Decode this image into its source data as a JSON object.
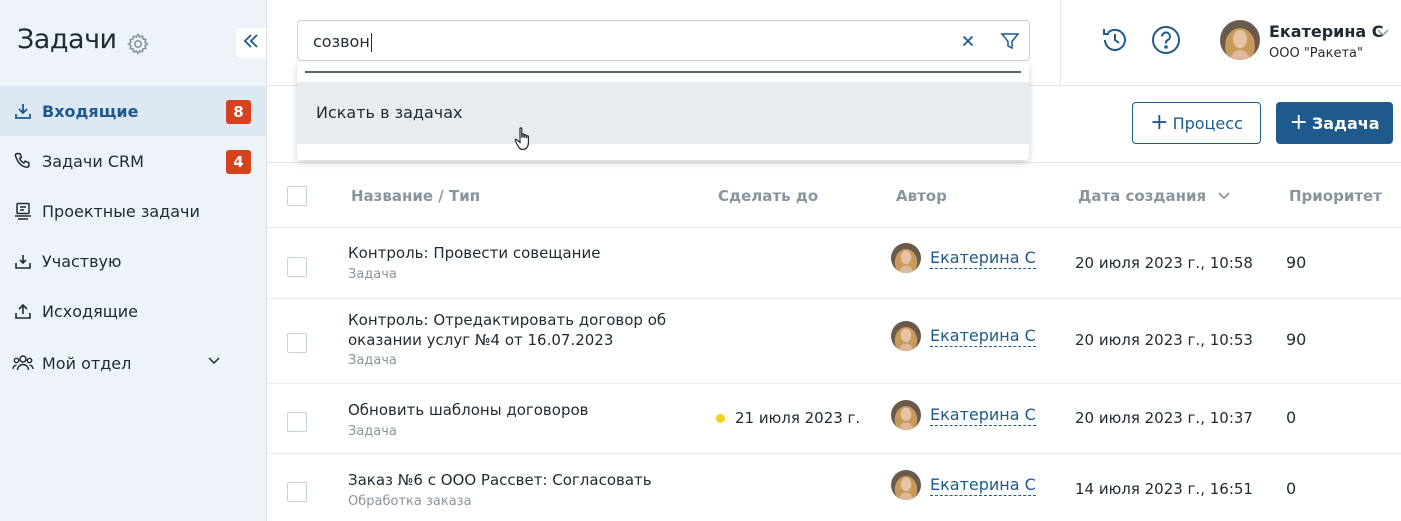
{
  "sidebar": {
    "title": "Задачи",
    "items": [
      {
        "label": "Входящие",
        "badge": "8",
        "icon": "inbox-icon"
      },
      {
        "label": "Задачи CRM",
        "badge": "4",
        "icon": "phone-icon"
      },
      {
        "label": "Проектные задачи",
        "badge": null,
        "icon": "project-icon"
      },
      {
        "label": "Участвую",
        "badge": null,
        "icon": "participate-icon"
      },
      {
        "label": "Исходящие",
        "badge": null,
        "icon": "outbox-icon"
      },
      {
        "label": "Мой отдел",
        "badge": null,
        "icon": "team-icon"
      }
    ]
  },
  "search": {
    "value": "созвон",
    "suggestion": "Искать в задачах"
  },
  "user": {
    "name": "Екатерина С",
    "org": "ООО \"Ракета\""
  },
  "actions": {
    "process_label": "Процесс",
    "task_label": "Задача"
  },
  "table": {
    "columns": {
      "title": "Название / Тип",
      "due": "Сделать до",
      "author": "Автор",
      "created": "Дата создания",
      "priority": "Приоритет"
    },
    "rows": [
      {
        "title": "Контроль: Провести совещание",
        "type": "Задача",
        "due": "",
        "author": "Екатерина С",
        "created": "20 июля 2023 г., 10:58",
        "priority": "90"
      },
      {
        "title": "Контроль: Отредактировать договор об оказании услуг №4 от 16.07.2023",
        "type": "Задача",
        "due": "",
        "author": "Екатерина С",
        "created": "20 июля 2023 г., 10:53",
        "priority": "90"
      },
      {
        "title": "Обновить шаблоны договоров",
        "type": "Задача",
        "due": "21 июля 2023 г.",
        "author": "Екатерина С",
        "created": "20 июля 2023 г., 10:37",
        "priority": "0"
      },
      {
        "title": "Заказ №6 с ООО Рассвет: Согласовать",
        "type": "Обработка заказа",
        "due": "",
        "author": "Екатерина С",
        "created": "14 июля 2023 г., 16:51",
        "priority": "0"
      }
    ]
  },
  "colors": {
    "accent": "#1e5a8c",
    "badge": "#d6411e",
    "sidebar_bg": "#eef3f9",
    "due_dot": "#f2d01c"
  }
}
